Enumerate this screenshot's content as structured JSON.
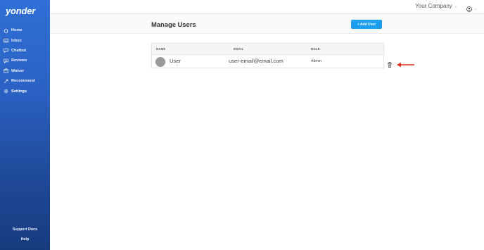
{
  "sidebar": {
    "logo": "yonder",
    "items": [
      {
        "label": "Home",
        "icon": "home-icon"
      },
      {
        "label": "Inbox",
        "icon": "inbox-icon"
      },
      {
        "label": "Chatbot",
        "icon": "chat-icon"
      },
      {
        "label": "Reviews",
        "icon": "reviews-icon"
      },
      {
        "label": "Waiver",
        "icon": "waiver-icon"
      },
      {
        "label": "Recommend",
        "icon": "recommend-icon"
      },
      {
        "label": "Settings",
        "icon": "settings-icon",
        "active": true
      }
    ],
    "footer": {
      "support": "Support Docs",
      "help": "Help"
    }
  },
  "topbar": {
    "company": "Your Company",
    "user_icon": "user-circle-icon"
  },
  "page": {
    "title": "Manage Users",
    "add_button": "+ Add User"
  },
  "table": {
    "headers": {
      "name": "NAME",
      "email": "EMAIL",
      "role": "ROLE"
    },
    "rows": [
      {
        "name": "User",
        "email": "user-email@email.com",
        "role": "Admin"
      }
    ]
  },
  "colors": {
    "sidebar_top": "#2f6fd6",
    "sidebar_bottom": "#173a7e",
    "accent": "#1a9ef0",
    "arrow": "#e0301e"
  }
}
